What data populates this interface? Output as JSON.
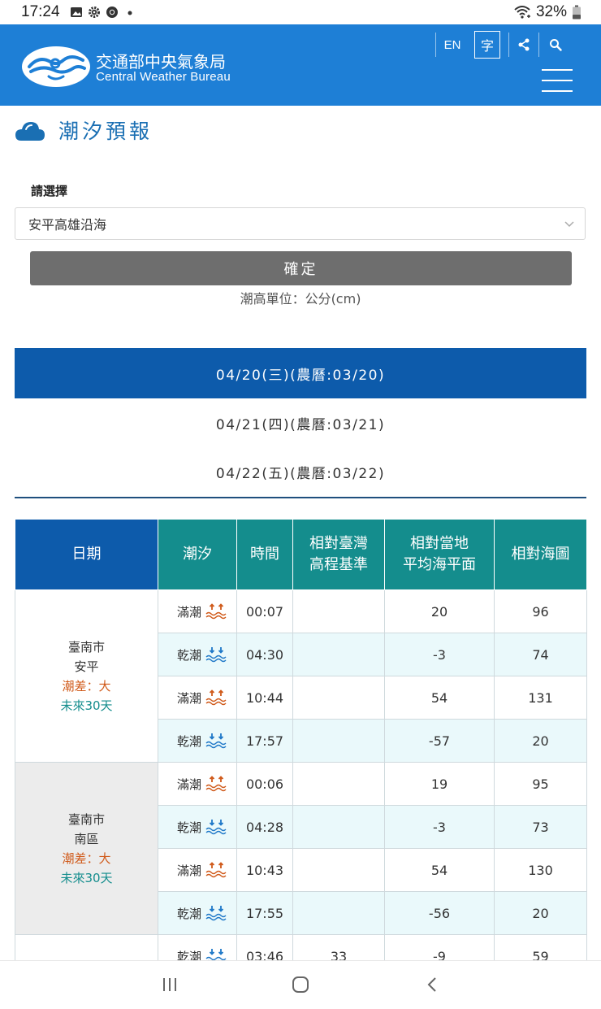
{
  "status": {
    "time": "17:24",
    "battery": "32%"
  },
  "header": {
    "brand_zh": "交通部中央氣象局",
    "brand_en": "Central Weather Bureau",
    "lang_btn": "EN",
    "font_btn": "字"
  },
  "page": {
    "title": "潮汐預報",
    "select_label": "請選擇",
    "selected_area": "安平高雄沿海",
    "confirm_label": "確定",
    "unit_text": "潮高單位：公分(cm)"
  },
  "tabs": [
    {
      "label": "04/20(三)(農曆:03/20)",
      "active": true
    },
    {
      "label": "04/21(四)(農曆:03/21)",
      "active": false
    },
    {
      "label": "04/22(五)(農曆:03/22)",
      "active": false
    }
  ],
  "table": {
    "headers": {
      "date": "日期",
      "tide": "潮汐",
      "time": "時間",
      "twvd_line1": "相對臺灣",
      "twvd_line2": "高程基準",
      "msl_line1": "相對當地",
      "msl_line2": "平均海平面",
      "chart": "相對海圖"
    },
    "locations": [
      {
        "city": "臺南市",
        "district": "安平",
        "range": "潮差：大",
        "future": "未來30天",
        "rows": [
          {
            "type": "滿潮",
            "kind": "high",
            "time": "00:07",
            "twvd": "",
            "msl": "20",
            "chart": "96"
          },
          {
            "type": "乾潮",
            "kind": "low",
            "time": "04:30",
            "twvd": "",
            "msl": "-3",
            "chart": "74"
          },
          {
            "type": "滿潮",
            "kind": "high",
            "time": "10:44",
            "twvd": "",
            "msl": "54",
            "chart": "131"
          },
          {
            "type": "乾潮",
            "kind": "low",
            "time": "17:57",
            "twvd": "",
            "msl": "-57",
            "chart": "20"
          }
        ]
      },
      {
        "city": "臺南市",
        "district": "南區",
        "range": "潮差：大",
        "future": "未來30天",
        "rows": [
          {
            "type": "滿潮",
            "kind": "high",
            "time": "00:06",
            "twvd": "",
            "msl": "19",
            "chart": "95"
          },
          {
            "type": "乾潮",
            "kind": "low",
            "time": "04:28",
            "twvd": "",
            "msl": "-3",
            "chart": "73"
          },
          {
            "type": "滿潮",
            "kind": "high",
            "time": "10:43",
            "twvd": "",
            "msl": "54",
            "chart": "130"
          },
          {
            "type": "乾潮",
            "kind": "low",
            "time": "17:55",
            "twvd": "",
            "msl": "-56",
            "chart": "20"
          }
        ]
      }
    ],
    "partial_row": {
      "type": "乾潮",
      "time": "03:46",
      "twvd": "33",
      "msl": "-9",
      "chart": "59"
    }
  },
  "colors": {
    "header_blue": "#1e7fd6",
    "tab_active": "#0d5bab",
    "table_teal": "#148d8d",
    "high_tide": "#d05a1a",
    "low_tide": "#1f78c8"
  },
  "icons": [
    "gallery-icon",
    "settings-icon",
    "chrome-icon",
    "wifi-icon",
    "battery-icon",
    "share-icon",
    "search-icon",
    "menu-icon",
    "cloud-icon",
    "chevron-down-icon",
    "high-tide-icon",
    "low-tide-icon",
    "recent-apps-icon",
    "home-icon",
    "back-icon"
  ]
}
